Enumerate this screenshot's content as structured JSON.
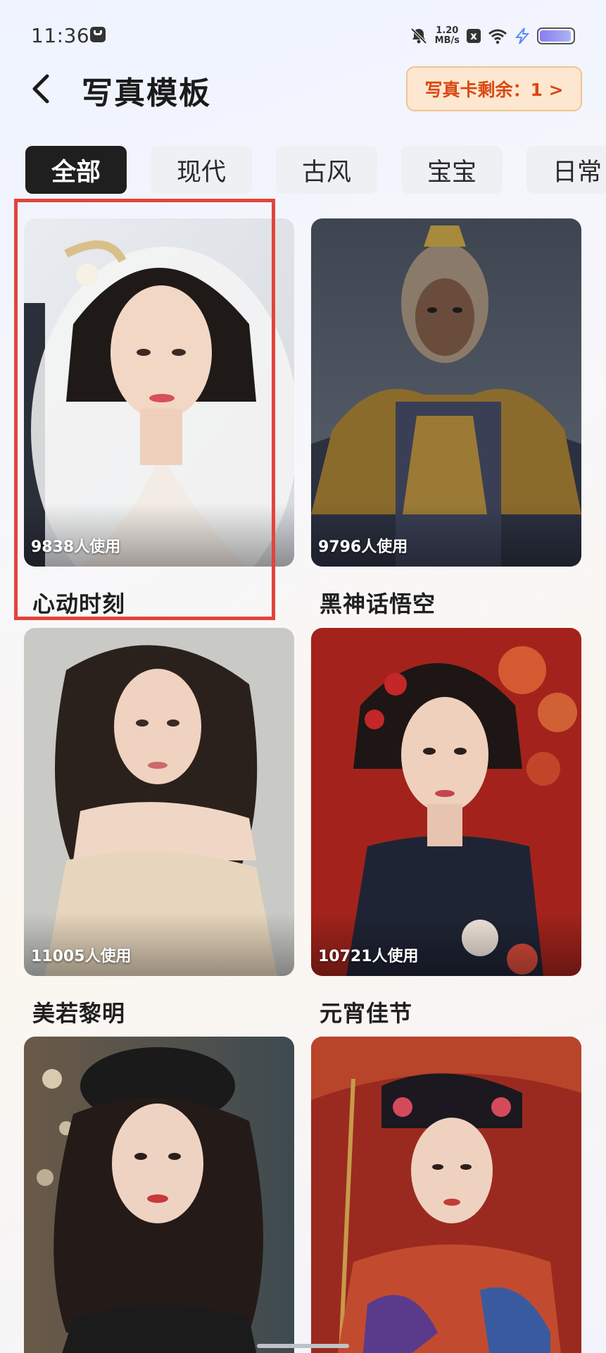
{
  "status_bar": {
    "time": "11:36",
    "net_speed_value": "1.20",
    "net_speed_unit": "MB/s",
    "x_badge": "x",
    "battery_fraction": 0.95
  },
  "header": {
    "title": "写真模板",
    "card_remaining": "写真卡剩余：1 >"
  },
  "tabs": [
    "全部",
    "现代",
    "古风",
    "宝宝",
    "日常"
  ],
  "active_tab": 0,
  "templates": [
    {
      "title": "心动时刻",
      "usage": "9838人使用"
    },
    {
      "title": "黑神话悟空",
      "usage": "9796人使用"
    },
    {
      "title": "美若黎明",
      "usage": "11005人使用"
    },
    {
      "title": "元宵佳节",
      "usage": "10721人使用"
    },
    {
      "title": "",
      "usage": ""
    },
    {
      "title": "",
      "usage": ""
    }
  ],
  "colors": {
    "accent_orange": "#d9480f",
    "card_button_bg": "#fde7d0",
    "active_tab_bg": "#1f1f1f",
    "highlight_border": "#e2443b"
  }
}
